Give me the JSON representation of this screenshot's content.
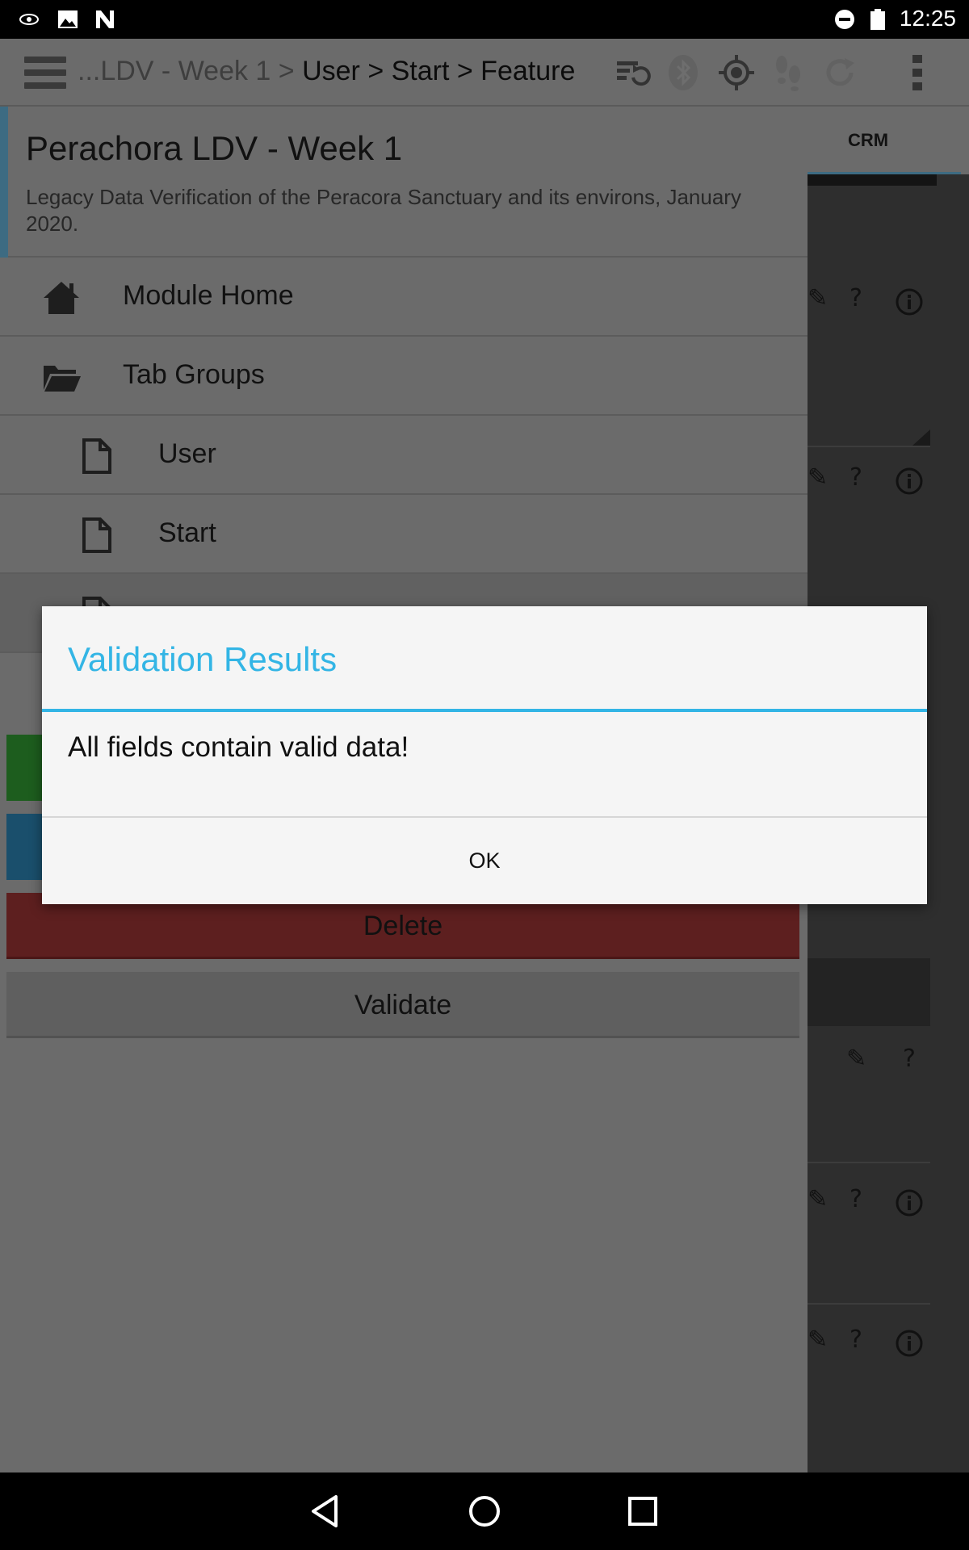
{
  "status_bar": {
    "time": "12:25",
    "icons": [
      "eye-icon",
      "image-icon",
      "n-logo-icon",
      "do-not-disturb-icon",
      "battery-icon"
    ]
  },
  "action_bar": {
    "menu_icon": "hamburger-icon",
    "breadcrumb_faded": "...LDV - Week 1 > ",
    "breadcrumb_main": "User > Start > Feature",
    "icons": [
      "sync-icon",
      "bluetooth-icon",
      "gps-icon",
      "tracker-icon",
      "refresh-icon",
      "overflow-icon"
    ]
  },
  "drawer": {
    "title": "Perachora LDV - Week 1",
    "subtitle": "Legacy Data Verification of the Peracora Sanctuary and its environs, January 2020.",
    "items": [
      {
        "label": "Module Home",
        "icon": "home-icon"
      },
      {
        "label": "Tab Groups",
        "icon": "folder-icon"
      },
      {
        "label": "User",
        "icon": "document-icon"
      },
      {
        "label": "Start",
        "icon": "document-icon"
      }
    ],
    "buttons": {
      "delete": "Delete",
      "validate": "Validate"
    }
  },
  "right_panel": {
    "tab_label": "CRM"
  },
  "dialog": {
    "title": "Validation Results",
    "message": "All fields contain valid data!",
    "ok_label": "OK"
  },
  "nav_bar": {
    "icons": [
      "back-icon",
      "home-icon",
      "recents-icon"
    ]
  },
  "colors": {
    "dialog_accent": "#33b5e5",
    "dim_overlay": "#6b6b6b",
    "delete_button": "#5d1f1f"
  }
}
